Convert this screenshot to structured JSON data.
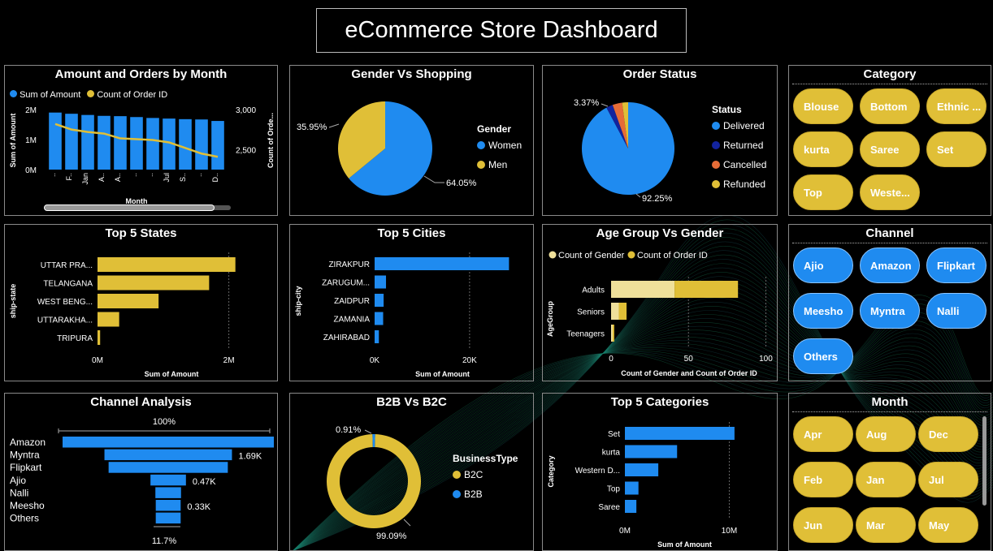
{
  "dashboard_title": "eCommerce Store Dashboard",
  "colors": {
    "blue": "#1f8bf0",
    "yellow": "#e0bf37",
    "dark_blue": "#12239e",
    "orange": "#e66c37",
    "light_yellow": "#efe09a",
    "background": "#000000"
  },
  "amount_orders_by_month": {
    "title": "Amount and Orders by Month",
    "legend": [
      "Sum of Amount",
      "Count of Order ID"
    ],
    "y_left_label": "Sum of Amount",
    "y_right_label": "Count of Orde...",
    "x_label": "Month",
    "y_left_ticks": [
      "2M",
      "1M",
      "0M"
    ],
    "y_right_ticks": [
      "3,000",
      "2,500"
    ],
    "x_ticks": [
      "..",
      "F..",
      "Jan",
      "A..",
      "A..",
      "..",
      "..",
      "Jul",
      "S..",
      "..",
      "D.."
    ],
    "chart_data": {
      "type": "bar+line",
      "categories": [
        "..",
        "F..",
        "Jan",
        "A..",
        "A..",
        "..",
        "..",
        "Jul",
        "S..",
        "..",
        "D.."
      ],
      "series": [
        {
          "name": "Sum of Amount",
          "values": [
            1900000,
            1860000,
            1820000,
            1790000,
            1780000,
            1750000,
            1720000,
            1700000,
            1680000,
            1670000,
            1620000
          ]
        },
        {
          "name": "Count of Order ID",
          "values": [
            2820,
            2750,
            2720,
            2700,
            2640,
            2630,
            2620,
            2590,
            2520,
            2450,
            2410
          ]
        }
      ],
      "ylim_left": [
        0,
        2000000
      ],
      "ylim_right": [
        2250,
        3000
      ]
    }
  },
  "gender_vs_shopping": {
    "title": "Gender Vs Shopping",
    "legend_title": "Gender",
    "legend": [
      "Women",
      "Men"
    ],
    "labels": [
      "64.05%",
      "35.95%"
    ],
    "chart_data": {
      "type": "pie",
      "categories": [
        "Women",
        "Men"
      ],
      "values": [
        64.05,
        35.95
      ]
    }
  },
  "order_status": {
    "title": "Order Status",
    "legend_title": "Status",
    "legend": [
      "Delivered",
      "Returned",
      "Cancelled",
      "Refunded"
    ],
    "labels": [
      "92.25%",
      "3.37%"
    ],
    "chart_data": {
      "type": "pie",
      "categories": [
        "Delivered",
        "Returned",
        "Cancelled",
        "Refunded"
      ],
      "values": [
        92.25,
        2.3,
        3.37,
        2.08
      ]
    }
  },
  "category_slicer": {
    "title": "Category",
    "items": [
      "Blouse",
      "Bottom",
      "Ethnic ...",
      "kurta",
      "Saree",
      "Set",
      "Top",
      "Weste..."
    ]
  },
  "channel_slicer": {
    "title": "Channel",
    "items": [
      "Ajio",
      "Amazon",
      "Flipkart",
      "Meesho",
      "Myntra",
      "Nalli",
      "Others"
    ]
  },
  "month_slicer": {
    "title": "Month",
    "items": [
      "Apr",
      "Aug",
      "Dec",
      "Feb",
      "Jan",
      "Jul",
      "Jun",
      "Mar",
      "May"
    ]
  },
  "top5_states": {
    "title": "Top 5 States",
    "y_label": "ship-state",
    "x_label": "Sum of Amount",
    "x_ticks": [
      "0M",
      "2M"
    ],
    "chart_data": {
      "type": "bar",
      "orientation": "horizontal",
      "categories": [
        "UTTAR PRA...",
        "TELANGANA",
        "WEST BENG...",
        "UTTARAKHA...",
        "TRIPURA"
      ],
      "values": [
        2100000,
        1700000,
        930000,
        330000,
        40000
      ],
      "xlim": [
        0,
        2500000
      ]
    }
  },
  "top5_cities": {
    "title": "Top 5 Cities",
    "y_label": "ship-city",
    "x_label": "Sum of Amount",
    "x_ticks": [
      "0K",
      "20K"
    ],
    "chart_data": {
      "type": "bar",
      "orientation": "horizontal",
      "categories": [
        "ZIRAKPUR",
        "ZARUGUM...",
        "ZAIDPUR",
        "ZAMANIA",
        "ZAHIRABAD"
      ],
      "values": [
        28300,
        2400,
        1900,
        1800,
        900
      ],
      "xlim": [
        0,
        32000
      ]
    }
  },
  "age_group_vs_gender": {
    "title": "Age Group Vs Gender",
    "legend": [
      "Count of Gender",
      "Count of Order ID"
    ],
    "y_label": "AgeGroup",
    "x_label": "Count of Gender and Count of Order ID",
    "x_ticks": [
      "0",
      "50",
      "100"
    ],
    "chart_data": {
      "type": "bar",
      "orientation": "horizontal-stacked",
      "categories": [
        "Adults",
        "Seniors",
        "Teenagers"
      ],
      "series": [
        {
          "name": "Count of Gender",
          "values": [
            41,
            5,
            1
          ]
        },
        {
          "name": "Count of Order ID",
          "values": [
            41,
            5,
            1
          ]
        }
      ],
      "xlim": [
        0,
        105
      ]
    }
  },
  "channel_analysis": {
    "title": "Channel Analysis",
    "top_label": "100%",
    "bottom_label": "11.7%",
    "data_labels": [
      "1.69K",
      "0.47K",
      "0.33K"
    ],
    "chart_data": {
      "type": "funnel",
      "categories": [
        "Amazon",
        "Myntra",
        "Flipkart",
        "Ajio",
        "Nalli",
        "Meesho",
        "Others"
      ],
      "values": [
        2800,
        1690,
        1580,
        470,
        340,
        330,
        330
      ]
    }
  },
  "b2b_vs_b2c": {
    "title": "B2B Vs B2C",
    "legend_title": "BusinessType",
    "legend": [
      "B2C",
      "B2B"
    ],
    "labels": [
      "0.91%",
      "99.09%"
    ],
    "chart_data": {
      "type": "donut",
      "categories": [
        "B2C",
        "B2B"
      ],
      "values": [
        99.09,
        0.91
      ]
    }
  },
  "top5_categories": {
    "title": "Top 5 Categories",
    "y_label": "Category",
    "x_label": "Sum of Amount",
    "x_ticks": [
      "0M",
      "10M"
    ],
    "chart_data": {
      "type": "bar",
      "orientation": "horizontal",
      "categories": [
        "Set",
        "kurta",
        "Western D...",
        "Top",
        "Saree"
      ],
      "values": [
        10500000,
        5000000,
        3200000,
        1300000,
        1100000
      ],
      "xlim": [
        0,
        13000000
      ]
    }
  }
}
